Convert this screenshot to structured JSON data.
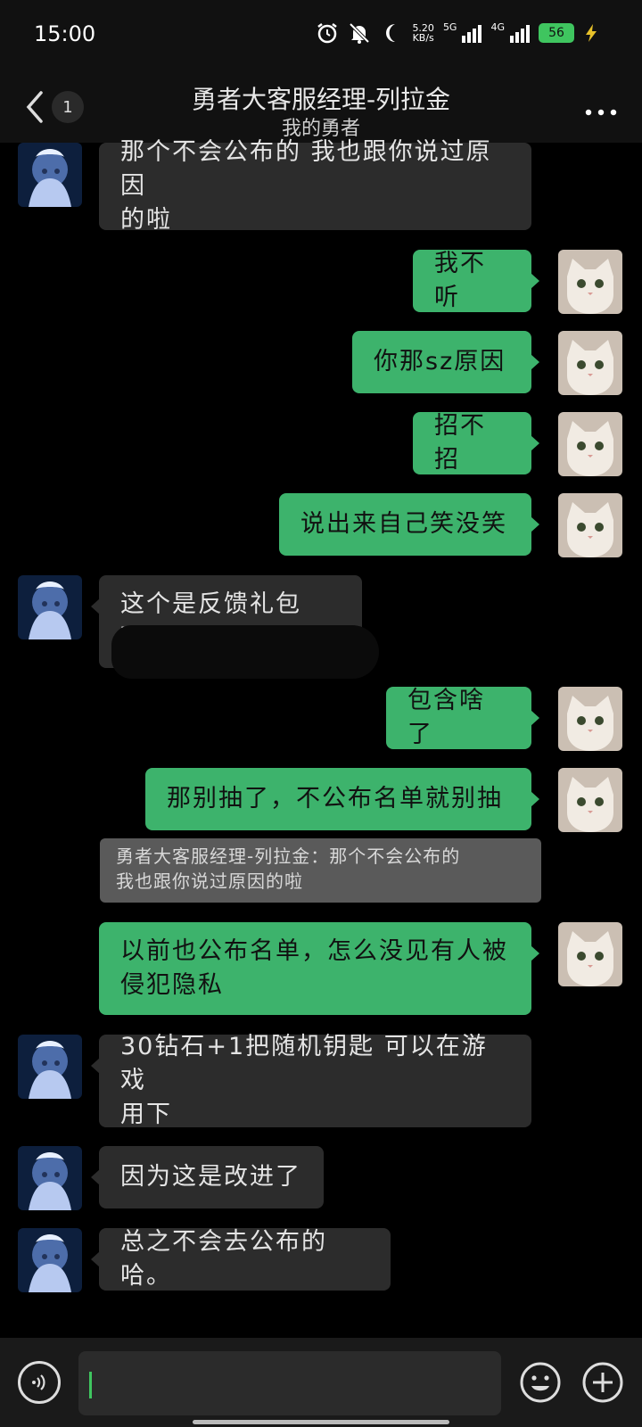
{
  "status": {
    "time": "15:00",
    "speed_value": "5.20",
    "speed_unit": "KB/s",
    "net1": "5G",
    "net2": "4G",
    "battery": "56",
    "icons": [
      "alarm-icon",
      "mute-bell-icon",
      "moon-icon",
      "signal-icon",
      "battery-icon",
      "charging-icon"
    ]
  },
  "header": {
    "unread": "1",
    "title": "勇者大客服经理-列拉金",
    "subtitle": "我的勇者"
  },
  "messages": [
    {
      "side": "in",
      "text": "那个不会公布的 我也跟你说过原因\n的啦"
    },
    {
      "side": "out",
      "text": "我不听"
    },
    {
      "side": "out",
      "text": "你那sz原因"
    },
    {
      "side": "out",
      "text": "招不招"
    },
    {
      "side": "out",
      "text": "说出来自己笑没笑"
    },
    {
      "side": "in",
      "text": "这个是反馈礼包码："
    },
    {
      "side": "out",
      "text": "包含啥了"
    },
    {
      "side": "out",
      "text": "那别抽了，不公布名单就别抽"
    },
    {
      "side": "out",
      "text": "以前也公布名单，怎么没见有人被\n侵犯隐私"
    },
    {
      "side": "in",
      "text": "30钻石+1把随机钥匙 可以在游戏\n用下"
    },
    {
      "side": "in",
      "text": "因为这是改进了"
    },
    {
      "side": "in",
      "text": "总之不会去公布的哈。"
    }
  ],
  "quote": "勇者大客服经理-列拉金：那个不会公布的\n我也跟你说过原因的啦",
  "input": {
    "value": "",
    "placeholder": ""
  },
  "colors": {
    "outgoing_bubble": "#3db36c",
    "incoming_bubble": "#2c2c2c",
    "quote_bubble": "#5a5a5a",
    "background": "#000000"
  }
}
